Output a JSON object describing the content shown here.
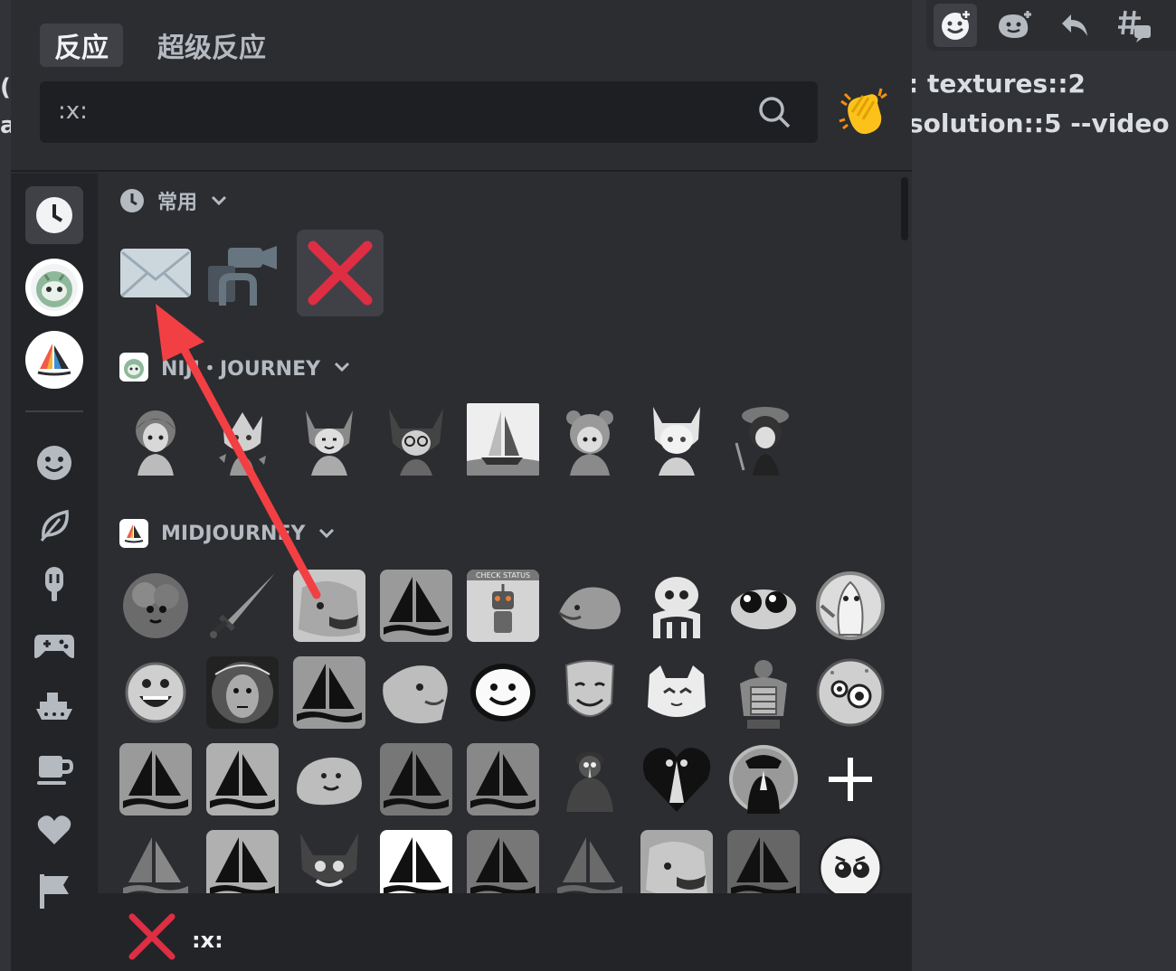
{
  "tabs": {
    "reactions": "反应",
    "super_reactions": "超级反应"
  },
  "search": {
    "value": ":x:",
    "icon": "search-icon"
  },
  "quick_reaction": {
    "icon": "clapping-hands-icon"
  },
  "background_chat": {
    "line1": ": textures::2",
    "line2": "solution::5 --video",
    "left_char1": "(",
    "left_char2": "a"
  },
  "toolbar": [
    "add-reaction-icon",
    "add-super-reaction-icon",
    "reply-icon",
    "create-thread-icon"
  ],
  "sidebar": [
    "frequently-used-icon",
    "niji-journey-guild-icon",
    "midjourney-guild-icon",
    "smiley-icon",
    "leaf-icon",
    "popsicle-icon",
    "controller-icon",
    "boat-icon",
    "coffee-icon",
    "heart-icon",
    "flag-icon"
  ],
  "sections": {
    "frequent": {
      "title": "常用",
      "emojis": [
        "envelope",
        "movie-camera",
        "cross-mark"
      ]
    },
    "niji": {
      "title": "NIJI・JOURNEY"
    },
    "midjourney": {
      "title": "MIDJOURNEY"
    }
  },
  "footer": {
    "emoji_name": ":x:"
  },
  "colors": {
    "accent_red": "#f23f43",
    "panel": "#2b2d31",
    "sidebar": "#232428"
  }
}
